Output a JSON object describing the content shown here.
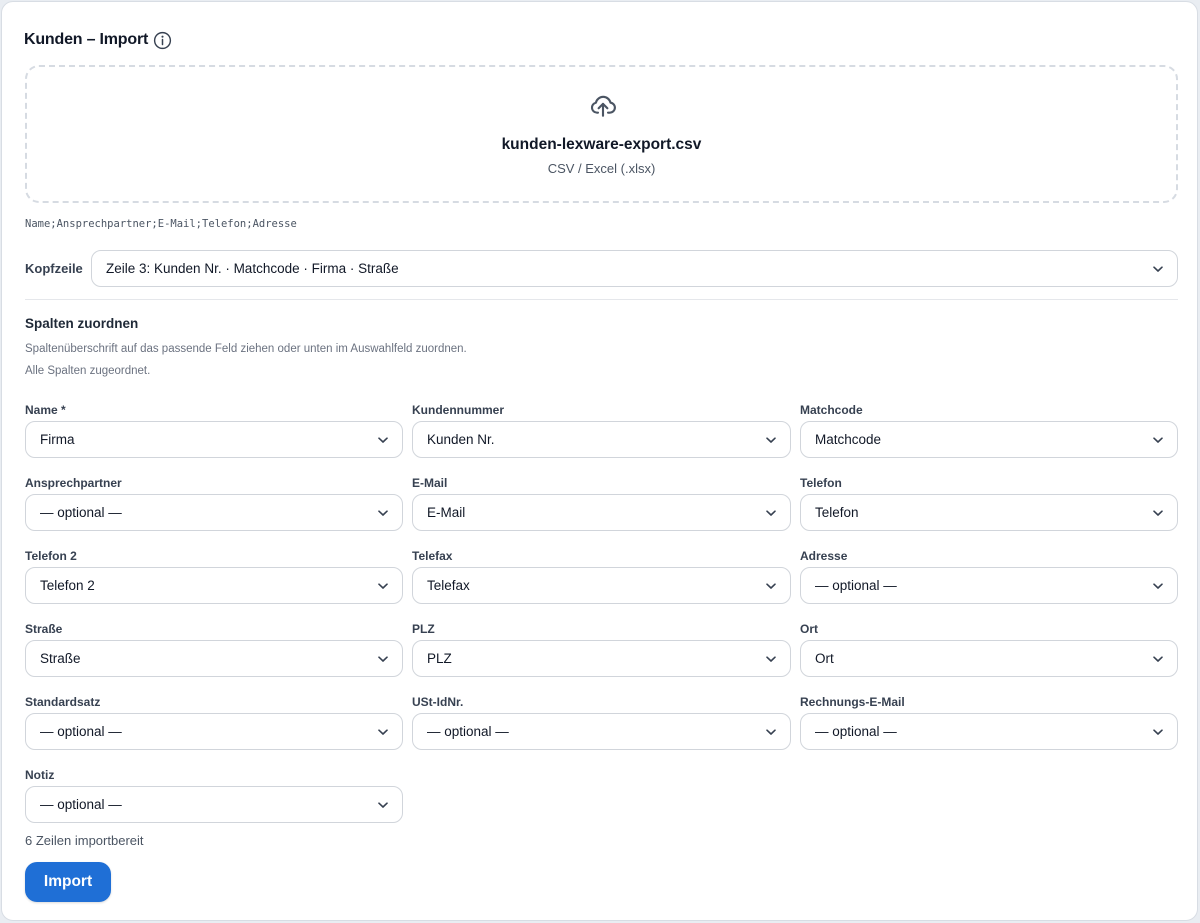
{
  "header": {
    "title": "Kunden – Import"
  },
  "upload": {
    "filename": "kunden-lexware-export.csv",
    "hint": "CSV / Excel (.xlsx)"
  },
  "preview_line": "Name;Ansprechpartner;E-Mail;Telefon;Adresse",
  "header_row": {
    "label": "Kopfzeile",
    "value": "Zeile 3: Kunden Nr. · Matchcode · Firma · Straße"
  },
  "mapping": {
    "title": "Spalten zuordnen",
    "description": "Spaltenüberschrift auf das passende Feld ziehen oder unten im Auswahlfeld zuordnen.",
    "status": "Alle Spalten zugeordnet.",
    "fields": [
      {
        "label": "Name *",
        "value": "Firma"
      },
      {
        "label": "Kundennummer",
        "value": "Kunden Nr."
      },
      {
        "label": "Matchcode",
        "value": "Matchcode"
      },
      {
        "label": "Ansprechpartner",
        "value": "— optional —"
      },
      {
        "label": "E-Mail",
        "value": "E-Mail"
      },
      {
        "label": "Telefon",
        "value": "Telefon"
      },
      {
        "label": "Telefon 2",
        "value": "Telefon 2"
      },
      {
        "label": "Telefax",
        "value": "Telefax"
      },
      {
        "label": "Adresse",
        "value": "— optional —"
      },
      {
        "label": "Straße",
        "value": "Straße"
      },
      {
        "label": "PLZ",
        "value": "PLZ"
      },
      {
        "label": "Ort",
        "value": "Ort"
      },
      {
        "label": "Standardsatz",
        "value": "— optional —"
      },
      {
        "label": "USt-IdNr.",
        "value": "— optional —"
      },
      {
        "label": "Rechnungs-E-Mail",
        "value": "— optional —"
      },
      {
        "label": "Notiz",
        "value": "— optional —"
      }
    ]
  },
  "footer": {
    "ready_text": "6 Zeilen importbereit",
    "import_label": "Import"
  },
  "colors": {
    "accent": "#1f6fd6"
  }
}
